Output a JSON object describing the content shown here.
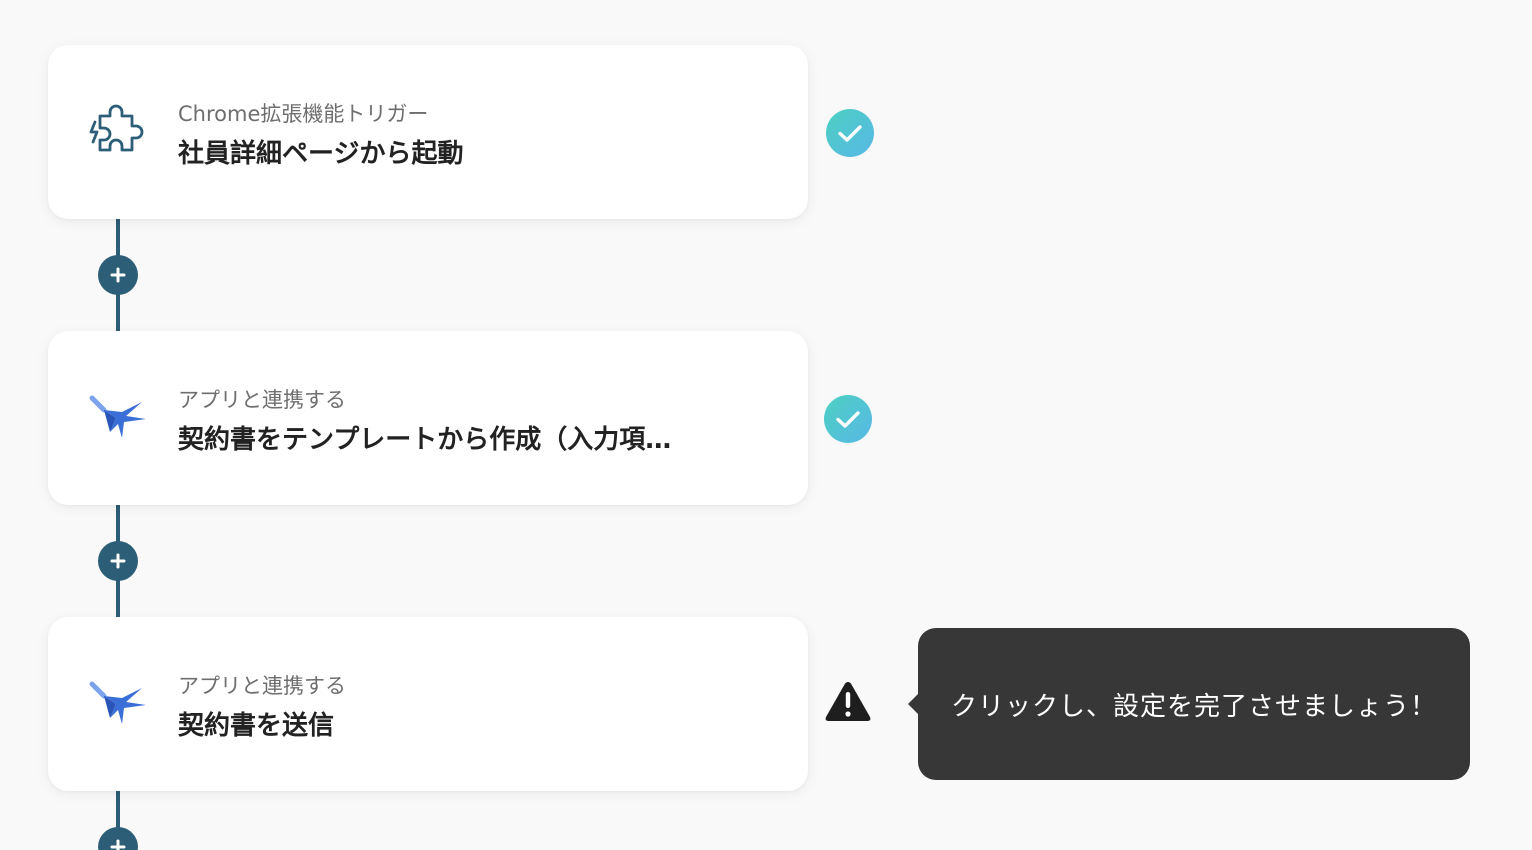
{
  "flow": {
    "steps": [
      {
        "subtitle": "Chrome拡張機能トリガー",
        "title": "社員詳細ページから起動",
        "icon": "puzzle-icon",
        "status": "complete"
      },
      {
        "subtitle": "アプリと連携する",
        "title": "契約書をテンプレートから作成（入力項…",
        "icon": "swallow-app-icon",
        "status": "complete"
      },
      {
        "subtitle": "アプリと連携する",
        "title": "契約書を送信",
        "icon": "swallow-app-icon",
        "status": "warning"
      }
    ],
    "add_step_icon": "plus-icon"
  },
  "tooltip": {
    "text": "クリックし、設定を完了させましょう！"
  },
  "colors": {
    "background": "#f9f9f9",
    "connector": "#2d5e77",
    "check_gradient_start": "#4cd0c1",
    "check_gradient_end": "#58b8e6",
    "warning": "#1e1e1e",
    "tooltip_bg": "#373737",
    "app_icon_blue": "#3a6fd8"
  }
}
